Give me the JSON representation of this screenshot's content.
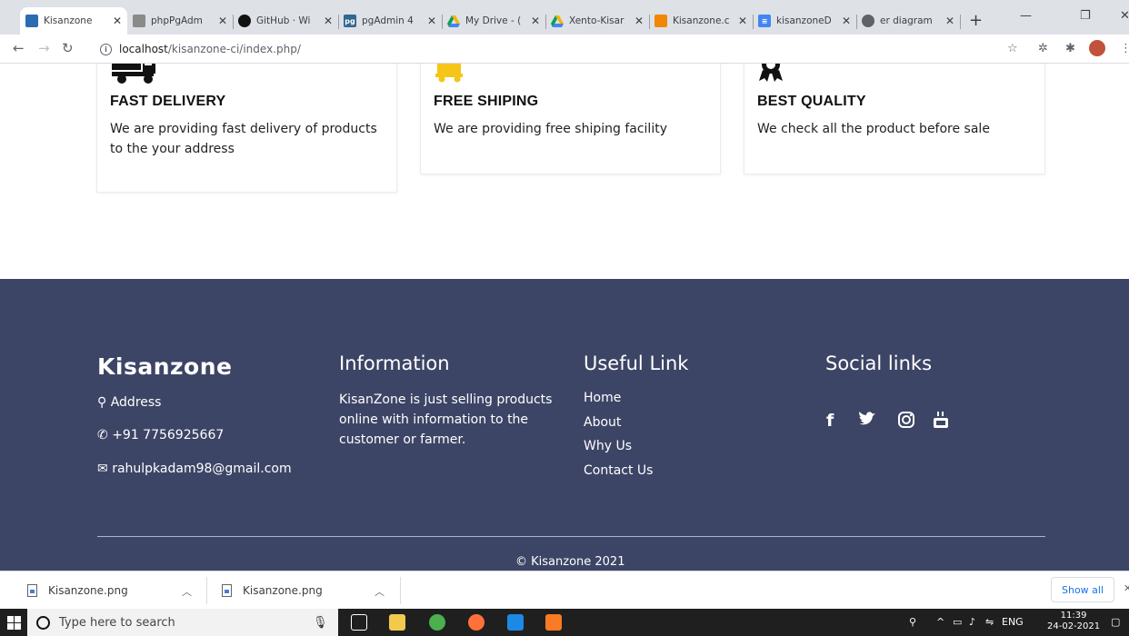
{
  "browser": {
    "tabs": [
      {
        "label": "Kisanzone",
        "icon": "kisanzone-favicon",
        "color": "#2b6cb0"
      },
      {
        "label": "phpPgAdm",
        "icon": "phppgadmin-favicon",
        "color": "#8a8a8a"
      },
      {
        "label": "GitHub · Wi",
        "icon": "github-favicon",
        "color": "#111111"
      },
      {
        "label": "pgAdmin 4",
        "icon": "pgadmin-favicon",
        "color": "#326690"
      },
      {
        "label": "My Drive - (",
        "icon": "drive-favicon",
        "color": "#f4b400"
      },
      {
        "label": "Xento-Kisar",
        "icon": "drive-favicon",
        "color": "#0f9d58"
      },
      {
        "label": "Kisanzone.c",
        "icon": "drawio-favicon",
        "color": "#f08705"
      },
      {
        "label": "kisanzoneD",
        "icon": "docs-favicon",
        "color": "#4285f4"
      },
      {
        "label": "er diagram",
        "icon": "globe-favicon",
        "color": "#5f6368"
      }
    ],
    "url_host": "localhost",
    "url_path": "/kisanzone-ci/index.php/"
  },
  "features": [
    {
      "title": "FAST DELIVERY",
      "text": "We are providing fast delivery of products to the your address",
      "icon": "truck-icon"
    },
    {
      "title": "FREE SHIPING",
      "text": "We are providing free shiping facility",
      "icon": "cart-icon"
    },
    {
      "title": "BEST QUALITY",
      "text": "We check all the product before sale",
      "icon": "award-icon"
    }
  ],
  "footer": {
    "brand": "Kisanzone",
    "address_label": "Address",
    "phone": "+91 7756925667",
    "email": "rahulpkadam98@gmail.com",
    "info_title": "Information",
    "info_text": "KisanZone is just selling products online with information to the customer or farmer.",
    "links_title": "Useful Link",
    "links": [
      "Home",
      "About",
      "Why Us",
      "Contact Us"
    ],
    "social_title": "Social links",
    "social": [
      "facebook-icon",
      "twitter-icon",
      "instagram-icon",
      "youtube-icon"
    ],
    "copyright": "© Kisanzone 2021"
  },
  "downloads": {
    "items": [
      "Kisanzone.png",
      "Kisanzone.png"
    ],
    "show_all": "Show all"
  },
  "taskbar": {
    "search_placeholder": "Type here to search",
    "lang": "ENG",
    "time": "11:39",
    "date": "24-02-2021"
  },
  "colors": {
    "footer_bg": "#3d4566",
    "delivery_accent": "#f5c518"
  }
}
